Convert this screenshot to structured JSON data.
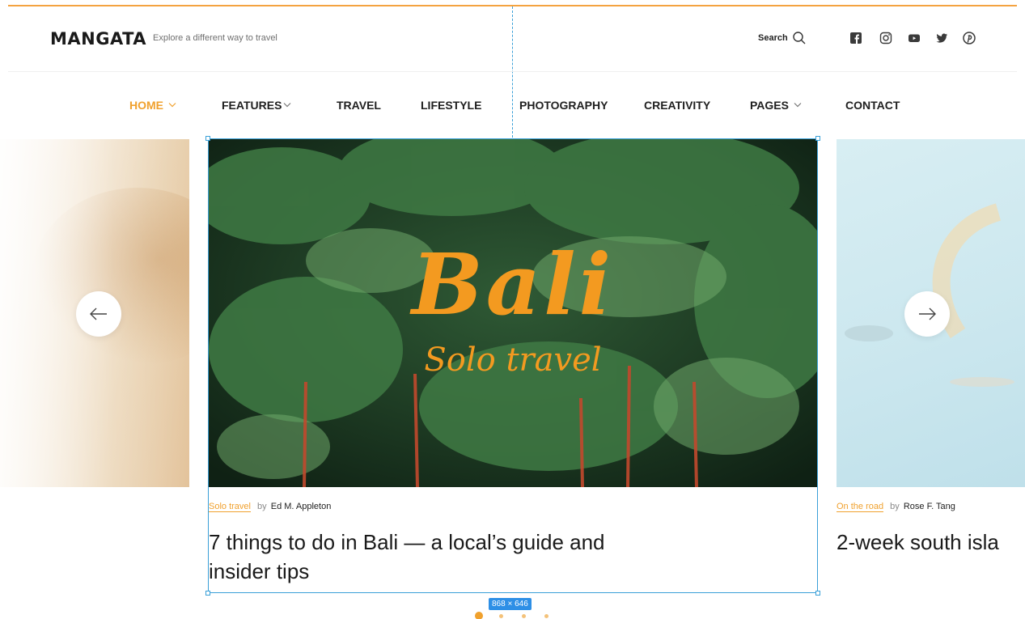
{
  "header": {
    "logo": "MANGATA",
    "tagline": "Explore a different way to travel",
    "search_label": "Search",
    "search_icon": "search-icon",
    "social_icons": [
      "facebook-icon",
      "instagram-icon",
      "youtube-icon",
      "twitter-icon",
      "pinterest-icon"
    ]
  },
  "nav": {
    "items": [
      {
        "label": "HOME",
        "dropdown": true,
        "active": true
      },
      {
        "label": "FEATURES",
        "dropdown": true,
        "active": false
      },
      {
        "label": "TRAVEL",
        "dropdown": false,
        "active": false
      },
      {
        "label": "LIFESTYLE",
        "dropdown": false,
        "active": false
      },
      {
        "label": "PHOTOGRAPHY",
        "dropdown": false,
        "active": false
      },
      {
        "label": "CREATIVITY",
        "dropdown": false,
        "active": false
      },
      {
        "label": "PAGES",
        "dropdown": true,
        "active": false
      },
      {
        "label": "CONTACT",
        "dropdown": false,
        "active": false
      }
    ]
  },
  "slider": {
    "main": {
      "image_title": "Bali",
      "image_subtitle": "Solo travel",
      "category": "Solo travel",
      "by": "by",
      "author": "Ed M. Appleton",
      "headline_line1": "7 things to do in Bali — a local’s guide and",
      "headline_line2": "insider tips"
    },
    "right": {
      "category": "On the road",
      "by": "by",
      "author": "Rose F. Tang",
      "headline": "2-week south isla"
    },
    "prev_icon": "arrow-left-icon",
    "next_icon": "arrow-right-icon",
    "dots": 4,
    "active_dot": 0
  },
  "editor_overlay": {
    "size_badge": "868 × 646"
  },
  "colors": {
    "accent": "#f0a12e",
    "selection": "#3aa0d8",
    "badge": "#2d8fe6"
  }
}
